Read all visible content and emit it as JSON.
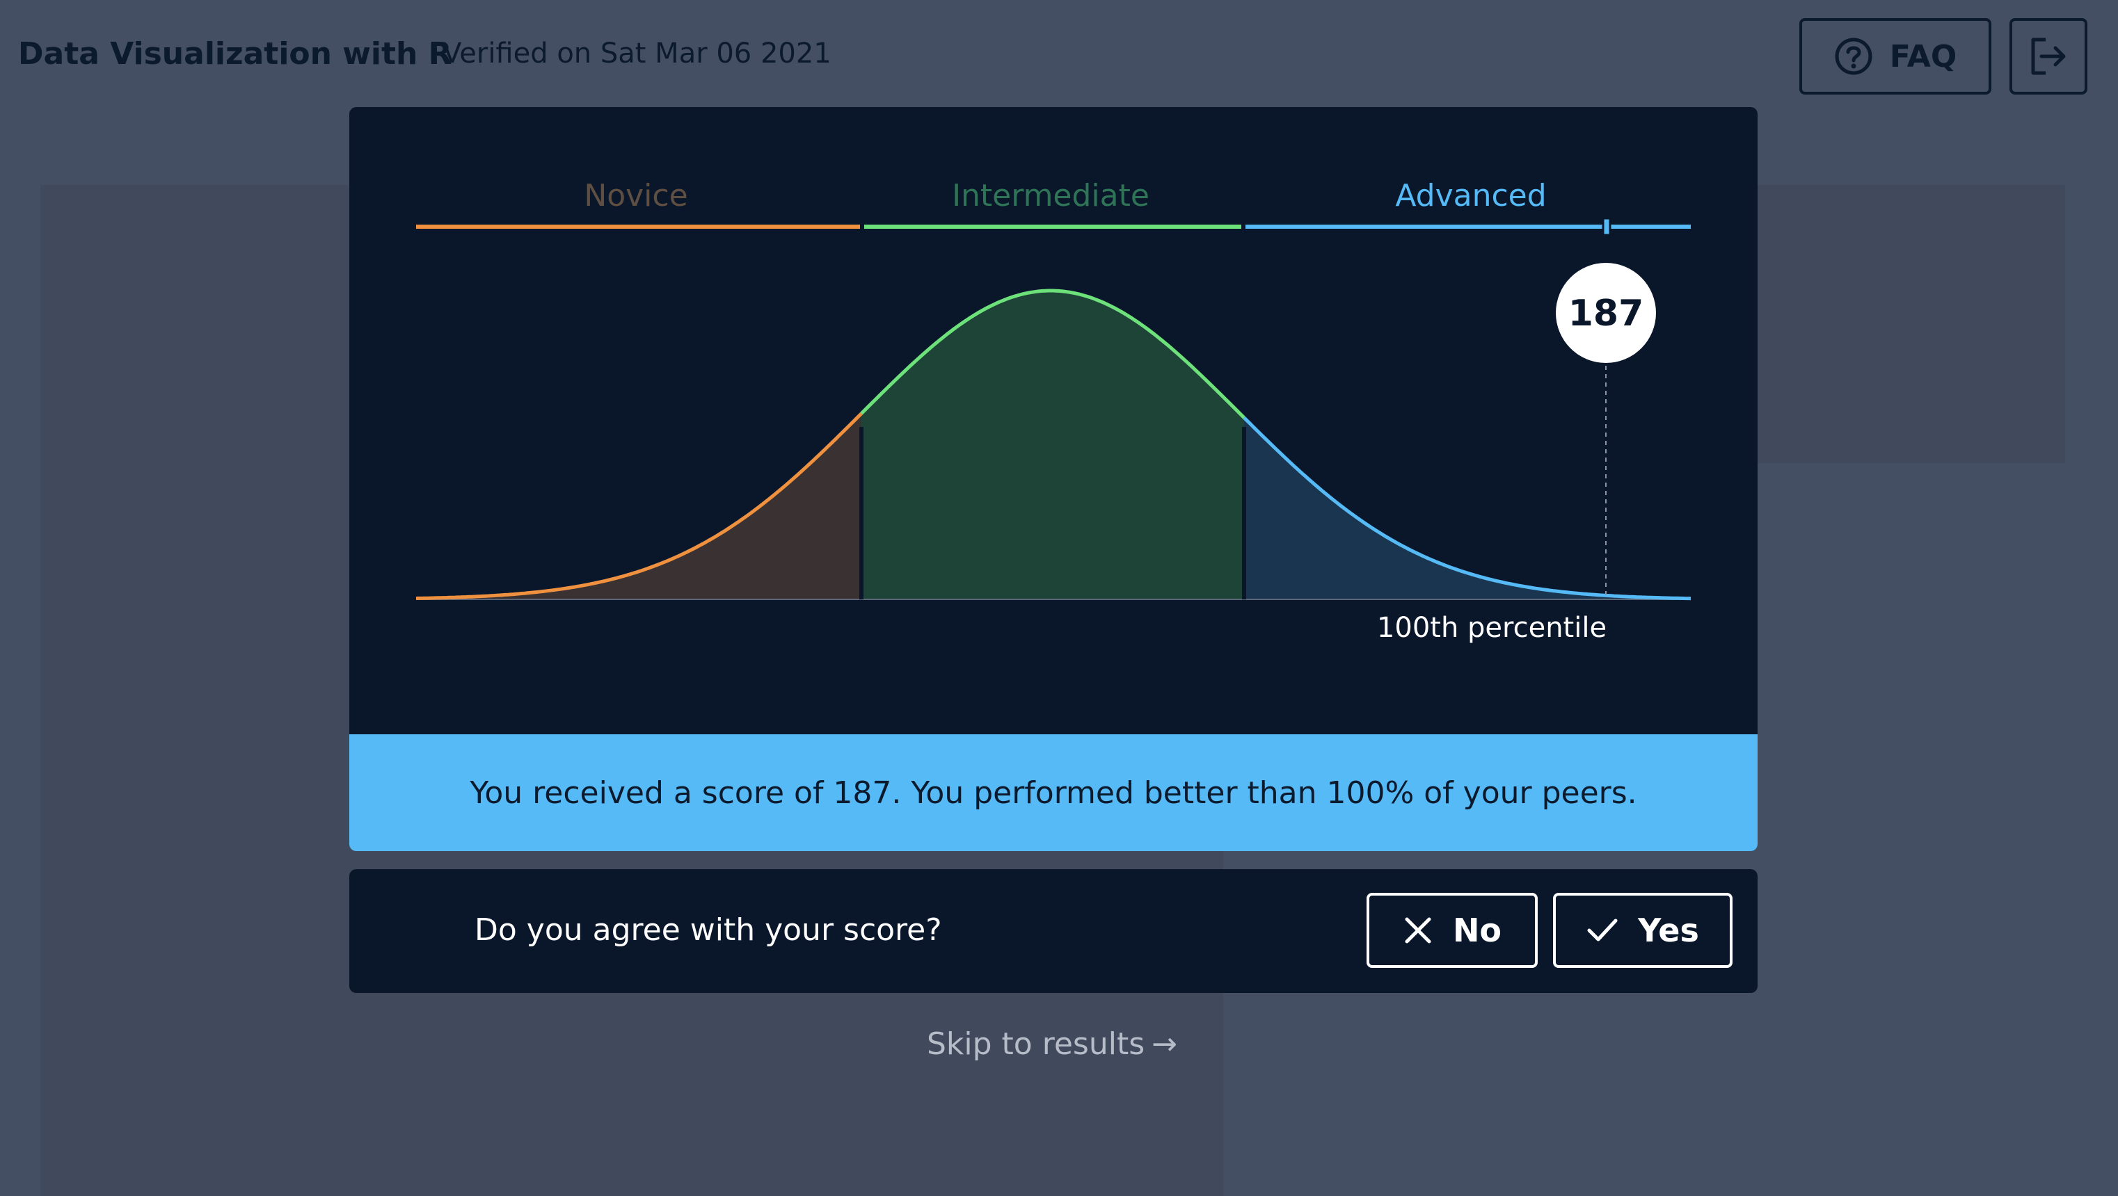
{
  "header": {
    "course_title": "Data Visualization with R",
    "verified_text": "Verified on Sat Mar 06 2021",
    "faq_label": "FAQ",
    "faq_icon": "question-circle-icon",
    "exit_icon": "exit-icon"
  },
  "chart_data": {
    "type": "area",
    "levels": [
      {
        "name": "Novice",
        "color": "#f0913f",
        "fill": "#3a3232"
      },
      {
        "name": "Intermediate",
        "color": "#6de27a",
        "fill": "#1e4438"
      },
      {
        "name": "Advanced",
        "color": "#55baf5",
        "fill": "#19354f"
      }
    ],
    "score": "187",
    "percentile_label": "100th percentile",
    "grid": false
  },
  "banner": {
    "text": "You received a score of 187. You performed better than 100% of your peers."
  },
  "agree": {
    "question": "Do you agree with your score?",
    "no_label": "No",
    "yes_label": "Yes"
  },
  "skip": {
    "label": "Skip to results",
    "arrow": "→"
  },
  "colors": {
    "background": "#454f63",
    "modal": "#0a172b",
    "banner": "#55baf5"
  }
}
